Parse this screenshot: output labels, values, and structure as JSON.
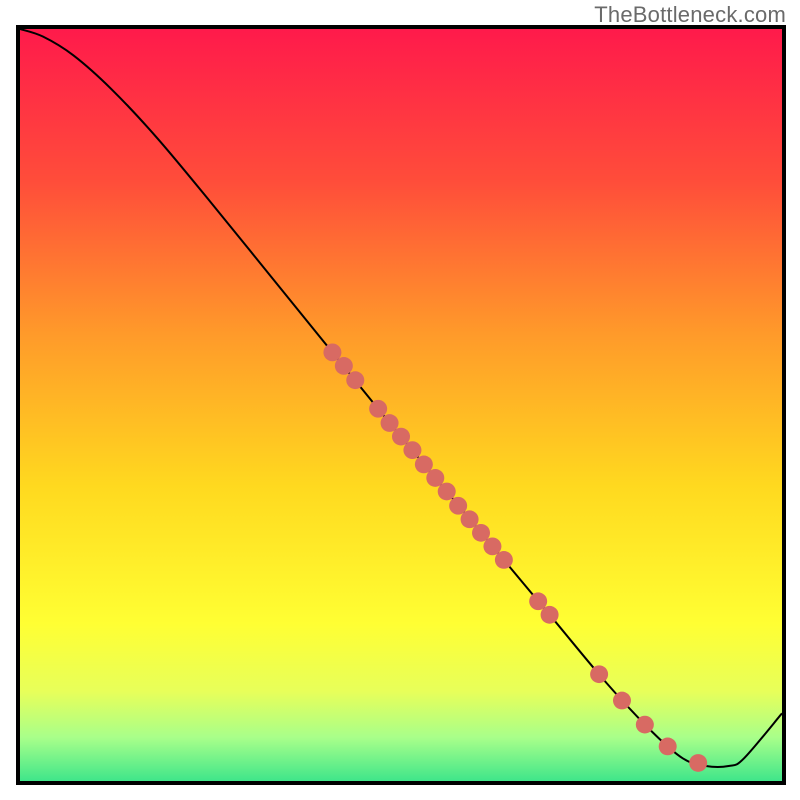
{
  "watermark": "TheBottleneck.com",
  "chart_data": {
    "type": "line",
    "title": "",
    "xlabel": "",
    "ylabel": "",
    "xlim": [
      0,
      100
    ],
    "ylim": [
      0,
      100
    ],
    "grid": false,
    "legend": false,
    "gradient_stops": [
      {
        "offset": 0.0,
        "color": "#ff1a4b"
      },
      {
        "offset": 0.2,
        "color": "#ff4d3a"
      },
      {
        "offset": 0.4,
        "color": "#ff9a2a"
      },
      {
        "offset": 0.6,
        "color": "#ffd91f"
      },
      {
        "offset": 0.78,
        "color": "#ffff33"
      },
      {
        "offset": 0.87,
        "color": "#e7ff5a"
      },
      {
        "offset": 0.93,
        "color": "#a8ff8a"
      },
      {
        "offset": 1.0,
        "color": "#27e08a"
      }
    ],
    "curve": [
      {
        "x": 0.0,
        "y": 100.0
      },
      {
        "x": 3.0,
        "y": 99.0
      },
      {
        "x": 7.0,
        "y": 96.5
      },
      {
        "x": 12.0,
        "y": 92.0
      },
      {
        "x": 18.0,
        "y": 85.5
      },
      {
        "x": 25.0,
        "y": 77.0
      },
      {
        "x": 33.0,
        "y": 67.0
      },
      {
        "x": 41.0,
        "y": 57.0
      },
      {
        "x": 49.0,
        "y": 47.0
      },
      {
        "x": 56.0,
        "y": 38.5
      },
      {
        "x": 63.0,
        "y": 30.0
      },
      {
        "x": 70.0,
        "y": 21.5
      },
      {
        "x": 77.0,
        "y": 13.0
      },
      {
        "x": 83.0,
        "y": 6.5
      },
      {
        "x": 87.0,
        "y": 3.0
      },
      {
        "x": 90.0,
        "y": 2.0
      },
      {
        "x": 93.0,
        "y": 2.0
      },
      {
        "x": 95.0,
        "y": 3.0
      },
      {
        "x": 100.0,
        "y": 9.0
      }
    ],
    "scatter": [
      {
        "x": 41.0,
        "y": 57.0
      },
      {
        "x": 42.5,
        "y": 55.2
      },
      {
        "x": 44.0,
        "y": 53.3
      },
      {
        "x": 47.0,
        "y": 49.5
      },
      {
        "x": 48.5,
        "y": 47.6
      },
      {
        "x": 50.0,
        "y": 45.8
      },
      {
        "x": 51.5,
        "y": 44.0
      },
      {
        "x": 53.0,
        "y": 42.1
      },
      {
        "x": 54.5,
        "y": 40.3
      },
      {
        "x": 56.0,
        "y": 38.5
      },
      {
        "x": 57.5,
        "y": 36.6
      },
      {
        "x": 59.0,
        "y": 34.8
      },
      {
        "x": 60.5,
        "y": 33.0
      },
      {
        "x": 62.0,
        "y": 31.2
      },
      {
        "x": 63.5,
        "y": 29.4
      },
      {
        "x": 68.0,
        "y": 23.9
      },
      {
        "x": 69.5,
        "y": 22.1
      },
      {
        "x": 76.0,
        "y": 14.2
      },
      {
        "x": 79.0,
        "y": 10.7
      },
      {
        "x": 82.0,
        "y": 7.5
      },
      {
        "x": 85.0,
        "y": 4.6
      },
      {
        "x": 89.0,
        "y": 2.4
      }
    ],
    "scatter_color": "#d86a63",
    "scatter_radius": 9,
    "line_color": "#000000",
    "line_width": 2
  }
}
